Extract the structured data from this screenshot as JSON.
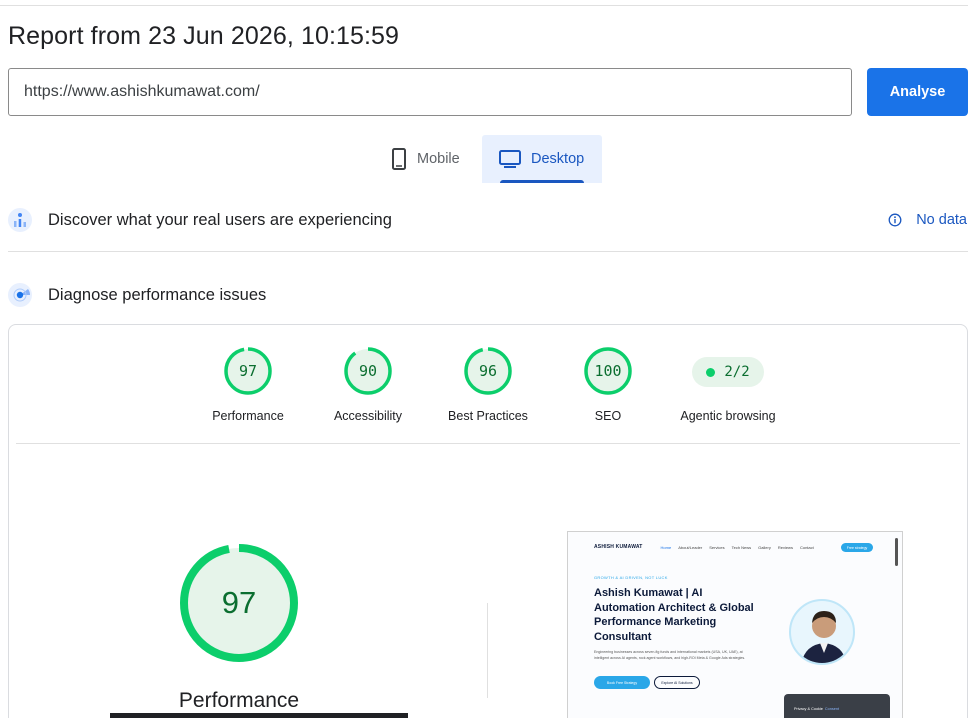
{
  "report": {
    "title": "Report from 23 Jun 2026, 10:15:59",
    "url_value": "https://www.ashishkumawat.com/",
    "analyse_label": "Analyse"
  },
  "tabs": [
    {
      "label": "Mobile",
      "icon": "phone-icon",
      "selected": false
    },
    {
      "label": "Desktop",
      "icon": "desktop-icon",
      "selected": true
    }
  ],
  "real_users": {
    "heading": "Discover what your real users are experiencing",
    "icon": "crux-icon",
    "status_label": "No data",
    "status_icon": "info-icon"
  },
  "diagnose": {
    "heading": "Diagnose performance issues",
    "icon": "lighthouse-icon"
  },
  "scores": [
    {
      "label": "Performance",
      "value": "97"
    },
    {
      "label": "Accessibility",
      "value": "90"
    },
    {
      "label": "Best Practices",
      "value": "96"
    },
    {
      "label": "SEO",
      "value": "100"
    }
  ],
  "agentic": {
    "label": "Agentic browsing",
    "value": "2/2"
  },
  "main_score": {
    "label": "Performance",
    "value": "97"
  },
  "colors": {
    "pass": "#0cce6b",
    "pass_text": "#0b6e30",
    "pass_fill": "#e6f4ea",
    "accent": "#1a73e8",
    "tab_selected": "#1a57c0"
  },
  "screenshot": {
    "brand": "ASHISH KUMAWAT",
    "nav_links": [
      "Home",
      "About/Leader",
      "Services",
      "Tech News",
      "Gallery",
      "Reviews",
      "Contact"
    ],
    "nav_cta": "Free strategy",
    "kicker": "GROWTH & AI DRIVEN, NOT LUCK",
    "hero": "Ashish Kumawat | AI Automation Architect & Global Performance Marketing Consultant",
    "sub": "Engineering businesses across seven-fig funds and international markets (USA, UK, UAE), at intelligent across AI agents, rock agent workflows, and high-ROI Meta & Google Ads strategies.",
    "btn_primary": "Book Free Strategy",
    "btn_secondary": "Explore AI Solutions",
    "toast_text": "Privacy & Cookie",
    "toast_link": "Consent"
  }
}
